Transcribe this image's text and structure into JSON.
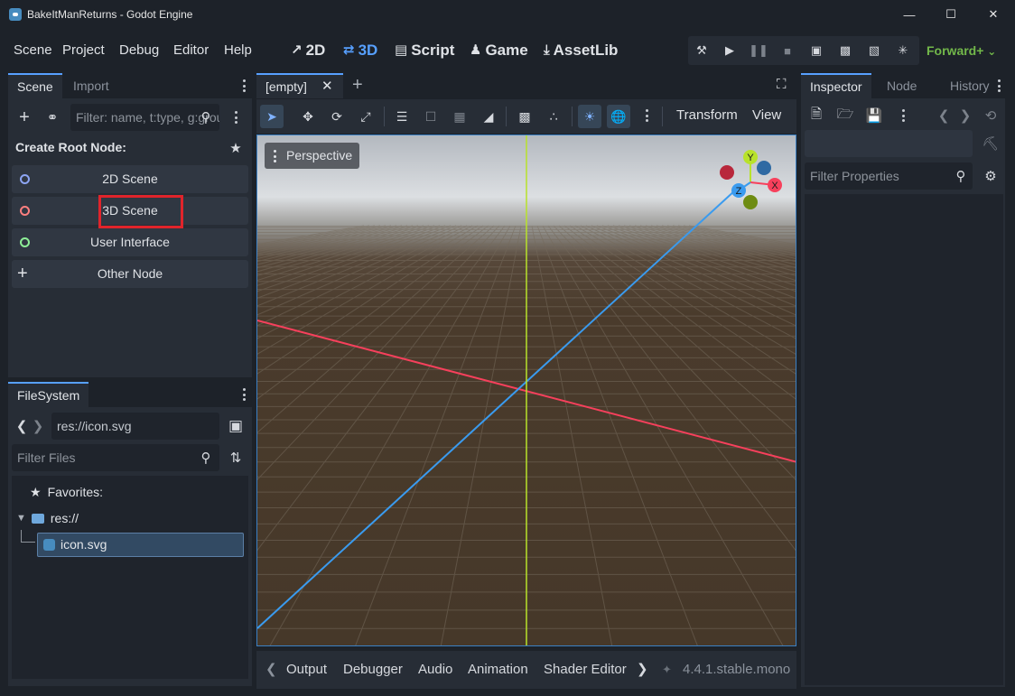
{
  "window": {
    "title": "BakeItManReturns - Godot Engine",
    "controls": [
      "minimize",
      "maximize",
      "close"
    ]
  },
  "menu": {
    "items": [
      "Scene",
      "Project",
      "Debug",
      "Editor",
      "Help"
    ]
  },
  "workspaces": [
    {
      "label": "2D",
      "icon": "2d-icon"
    },
    {
      "label": "3D",
      "icon": "3d-icon",
      "active": true
    },
    {
      "label": "Script",
      "icon": "script-icon"
    },
    {
      "label": "Game",
      "icon": "game-icon"
    },
    {
      "label": "AssetLib",
      "icon": "assetlib-icon"
    }
  ],
  "run_bar": {
    "buttons": [
      "build-icon",
      "play-icon",
      "pause-icon",
      "stop-icon",
      "run-current-icon",
      "run-custom-icon",
      "movie-icon",
      "remote-debug-icon"
    ]
  },
  "renderer": {
    "label": "Forward+",
    "color": "#72b84a"
  },
  "scene_dock": {
    "tabs": [
      "Scene",
      "Import"
    ],
    "filter_placeholder": "Filter: name, t:type, g:group",
    "create_root_title": "Create Root Node:",
    "root_buttons": [
      {
        "label": "2D Scene",
        "color": "#8da5f3"
      },
      {
        "label": "3D Scene",
        "color": "#fc7f7f",
        "highlighted": true
      },
      {
        "label": "User Interface",
        "color": "#8eef97"
      },
      {
        "label": "Other Node",
        "icon": "plus-icon"
      }
    ]
  },
  "filesystem_dock": {
    "tab": "FileSystem",
    "path": "res://icon.svg",
    "filter_placeholder": "Filter Files",
    "favorites": "Favorites:",
    "root": "res://",
    "files": [
      "icon.svg"
    ]
  },
  "editor_tabs": {
    "scene_tab": "[empty]"
  },
  "viewport": {
    "perspective_label": "Perspective",
    "menu_labels": [
      "Transform",
      "View"
    ],
    "gizmo_axes": [
      "X",
      "Y",
      "Z"
    ],
    "axis_colors": {
      "x": "#f7405c",
      "y": "#b8e22b",
      "z": "#3a9bef"
    }
  },
  "inspector": {
    "tabs": [
      "Inspector",
      "Node",
      "History"
    ],
    "filter_placeholder": "Filter Properties"
  },
  "bottom_panel": {
    "tabs": [
      "Output",
      "Debugger",
      "Audio",
      "Animation",
      "Shader Editor"
    ],
    "version": "4.4.1.stable.mono"
  }
}
